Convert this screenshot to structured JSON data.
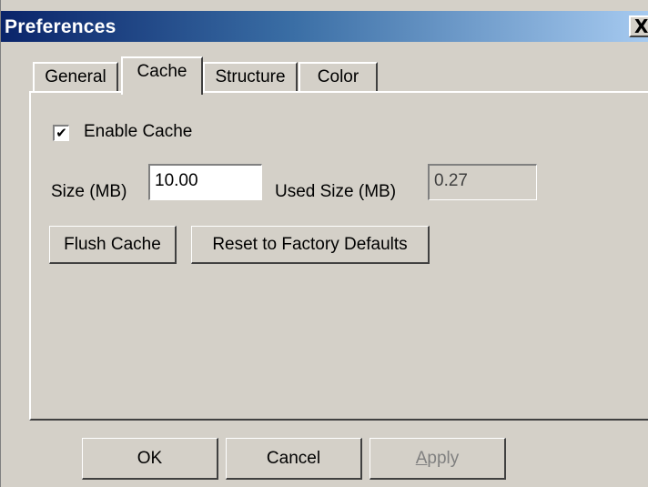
{
  "window": {
    "title": "Preferences",
    "close_glyph": "X"
  },
  "tabs": [
    {
      "label": "General",
      "active": false
    },
    {
      "label": "Cache",
      "active": true
    },
    {
      "label": "Structure",
      "active": false
    },
    {
      "label": "Color",
      "active": false
    }
  ],
  "cache_panel": {
    "enable_cache": {
      "label": "Enable Cache",
      "checked": true,
      "check_glyph": "✔"
    },
    "size_label": "Size (MB)",
    "size_value": "10.00",
    "used_size_label": "Used Size (MB)",
    "used_size_value": "0.27",
    "flush_button": "Flush Cache",
    "reset_button": "Reset to Factory Defaults"
  },
  "footer": {
    "ok": "OK",
    "cancel": "Cancel",
    "apply_mnemonic": "A",
    "apply_rest": "pply"
  },
  "colors": {
    "face": "#d4d0c8",
    "title_start": "#0a246a",
    "title_end": "#a6caf0"
  }
}
